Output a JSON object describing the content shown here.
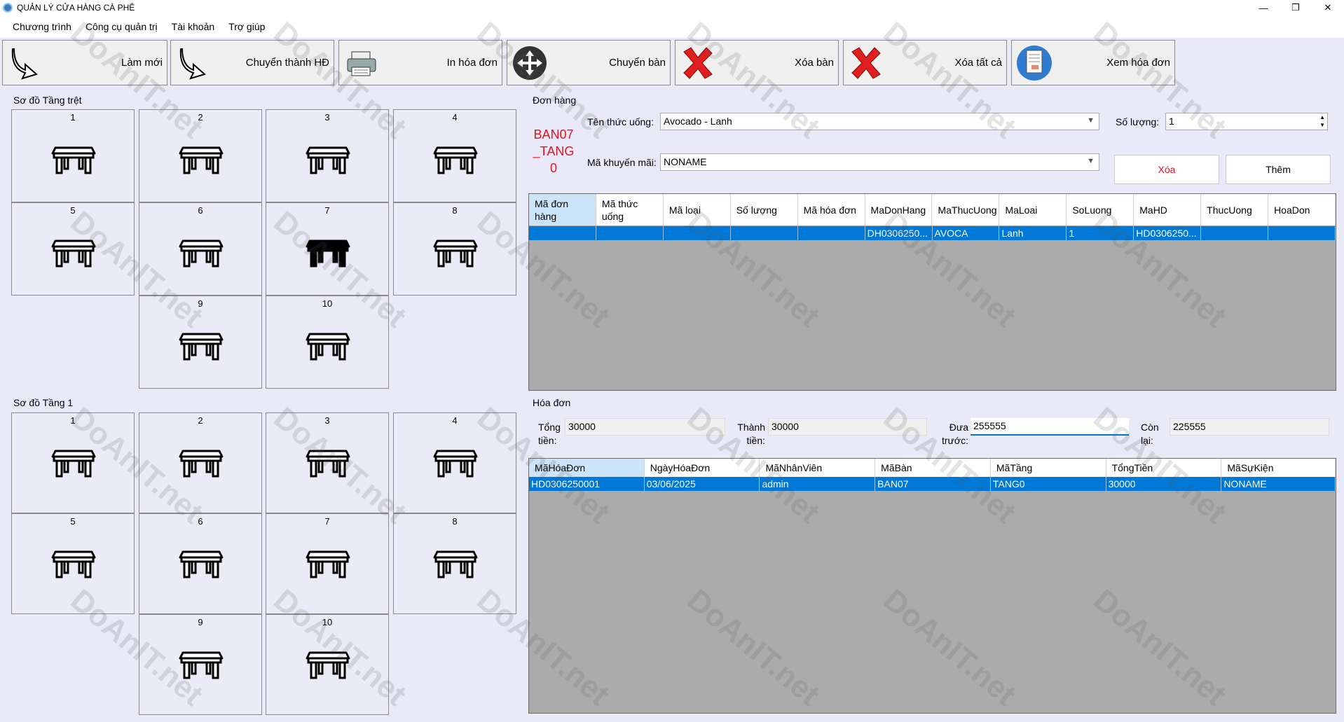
{
  "window": {
    "title": "QUẢN LÝ CỬA HÀNG CÀ PHÊ"
  },
  "menu": [
    "Chương trình",
    "Công cụ quản trị",
    "Tài khoản",
    "Trợ giúp"
  ],
  "toolbar": {
    "refresh_label": "Làm mới",
    "convert_label": "Chuyển thành HĐ",
    "print_label": "In hóa đơn",
    "move_table_label": "Chuyển bàn",
    "delete_table_label": "Xóa bàn",
    "delete_all_label": "Xóa tất cả",
    "view_invoice_label": "Xem hóa đơn"
  },
  "floors": [
    {
      "label": "Sơ đồ Tầng trệt",
      "tables": [
        "1",
        "2",
        "3",
        "4",
        "5",
        "6",
        "7",
        "8",
        "9",
        "10"
      ],
      "selected": "7"
    },
    {
      "label": "Sơ đồ Tầng 1",
      "tables": [
        "1",
        "2",
        "3",
        "4",
        "5",
        "6",
        "7",
        "8",
        "9",
        "10"
      ],
      "selected": ""
    }
  ],
  "order": {
    "section_label": "Đơn hàng",
    "table_code_lines": [
      "BAN07",
      "_TANG",
      "0"
    ],
    "drink_label": "Tên thức uống:",
    "drink_value": "Avocado - Lanh",
    "qty_label": "Số lượng:",
    "qty_value": "1",
    "promo_label": "Mã khuyến mãi:",
    "promo_value": "NONAME",
    "delete_button": "Xóa",
    "add_button": "Thêm",
    "columns": [
      "Mã đơn hàng",
      "Mã thức uống",
      "Mã loại",
      "Số lượng",
      "Mã hóa đơn",
      "MaDonHang",
      "MaThucUong",
      "MaLoai",
      "SoLuong",
      "MaHD",
      "ThucUong",
      "HoaDon"
    ],
    "rows": [
      [
        "",
        "",
        "",
        "",
        "",
        "DH0306250...",
        "AVOCA",
        "Lanh",
        "1",
        "HD0306250...",
        "",
        ""
      ]
    ]
  },
  "invoice": {
    "section_label": "Hóa đơn",
    "total_label": "Tổng tiền:",
    "total_value": "30000",
    "pay_label": "Thành tiền:",
    "pay_value": "30000",
    "given_label": "Đưa trước:",
    "given_value": "255555",
    "remain_label": "Còn lại:",
    "remain_value": "225555",
    "columns": [
      "MãHóaĐơn",
      "NgàyHóaĐơn",
      "MãNhânViên",
      "MãBàn",
      "MãTầng",
      "TổngTiền",
      "MãSựKiện"
    ],
    "rows": [
      [
        "HD0306250001",
        "03/06/2025",
        "admin",
        "BAN07",
        "TANG0",
        "30000",
        "NONAME"
      ]
    ]
  },
  "watermark": "DoAnIT.net",
  "colors": {
    "accent": "#0078d7",
    "red_text": "#e81123",
    "panel_bg": "#e9e9f7",
    "grid_bg": "#ababab"
  }
}
